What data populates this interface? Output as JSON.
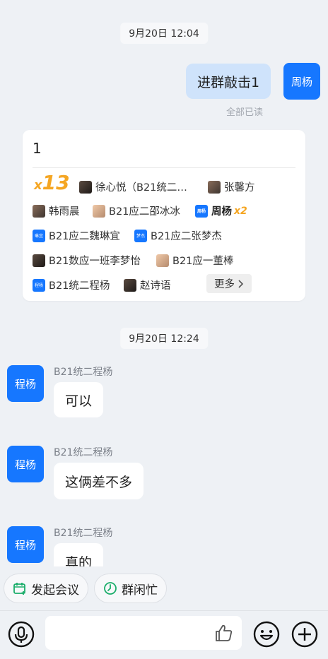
{
  "messages": {
    "time1": "9月20日 12:04",
    "my_avatar": "周杨",
    "my_message": "进群敲击1",
    "read_status": "全部已读",
    "time2": "9月20日 12:24"
  },
  "reaction_card": {
    "text": "1",
    "count_prefix": "x",
    "count": "13",
    "reactors": [
      {
        "name": "徐心悦（B21统二…",
        "avatar_label": ""
      },
      {
        "name": "张馨方",
        "avatar_label": ""
      },
      {
        "name": "韩雨晨",
        "avatar_label": ""
      },
      {
        "name": "B21应二邵冰冰",
        "avatar_label": ""
      },
      {
        "name": "周杨",
        "avatar_label": "周杨",
        "multiplier": "x2"
      },
      {
        "name": "B21应二魏琳宜",
        "avatar_label": "琳宜"
      },
      {
        "name": "B21应二张梦杰",
        "avatar_label": "梦杰"
      },
      {
        "name": "B21数应一班李梦怡",
        "avatar_label": ""
      },
      {
        "name": "B21应一董棒",
        "avatar_label": ""
      },
      {
        "name": "B21统二程杨",
        "avatar_label": "程杨"
      },
      {
        "name": "赵诗语",
        "avatar_label": ""
      }
    ],
    "more_label": "更多"
  },
  "chat": [
    {
      "avatar": "程杨",
      "sender": "B21统二程杨",
      "text": "可以"
    },
    {
      "avatar": "程杨",
      "sender": "B21统二程杨",
      "text": "这俩差不多"
    },
    {
      "avatar": "程杨",
      "sender": "B21统二程杨",
      "text": "真的"
    }
  ],
  "quick_actions": {
    "meeting": "发起会议",
    "busy": "群闲忙"
  },
  "icons": {
    "voice": "microphone-icon",
    "like": "thumbs-up-icon",
    "emoji": "emoji-icon",
    "add": "plus-icon"
  },
  "colors": {
    "accent": "#1677ff",
    "reaction_count": "#f5a623",
    "green": "#1aad6a"
  }
}
